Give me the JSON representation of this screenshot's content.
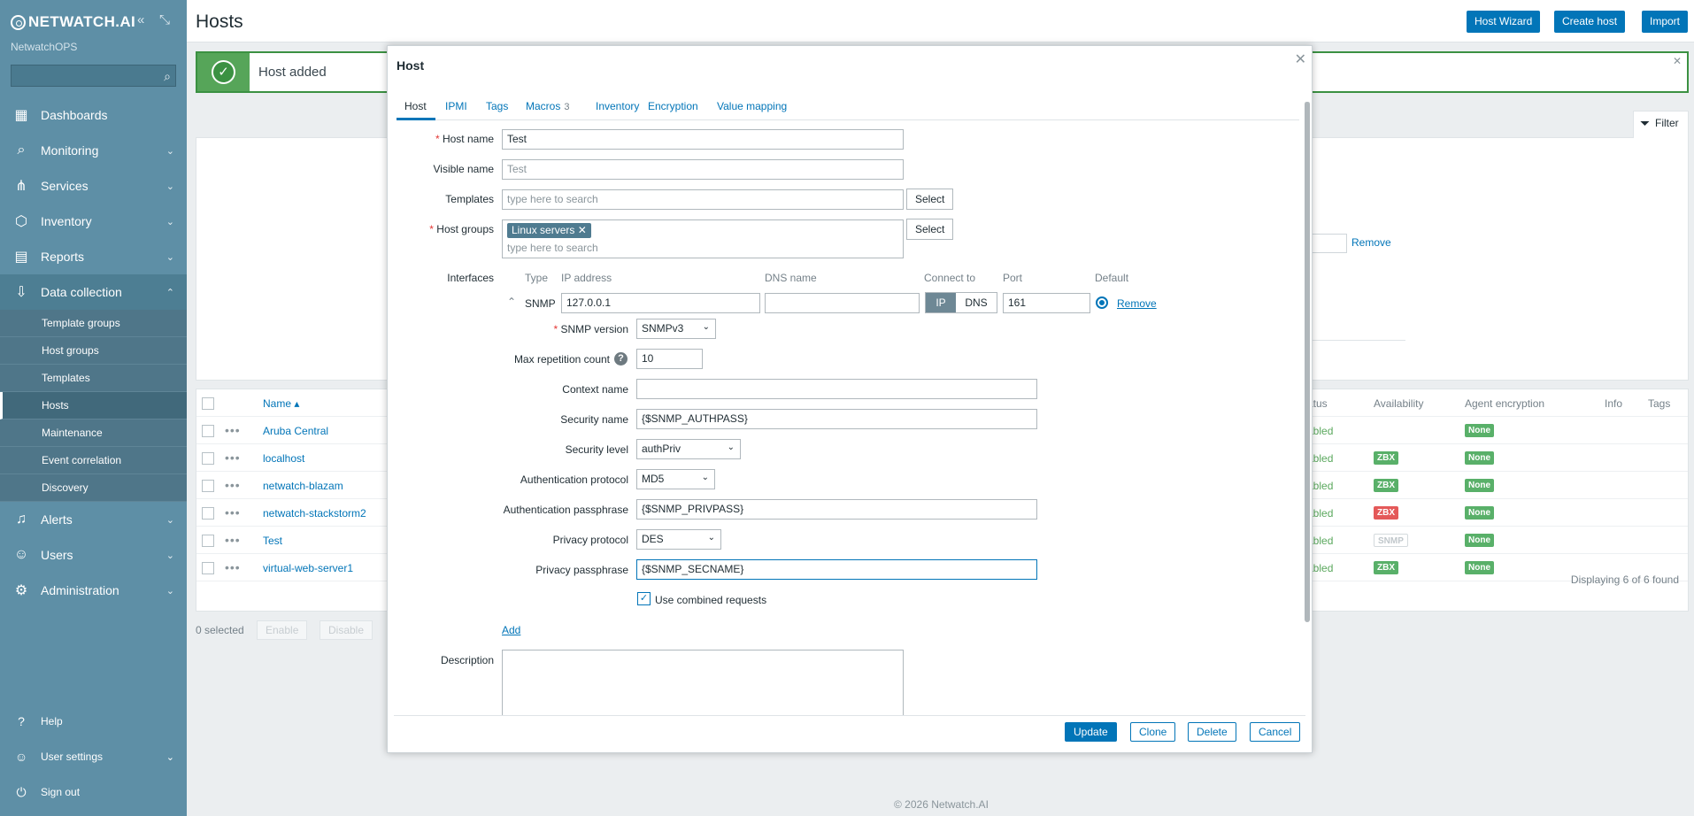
{
  "sidebar": {
    "logo": "NETWATCH.AI",
    "org": "NetwatchOPS",
    "nav": [
      {
        "label": "Dashboards",
        "icon": "dashboards-icon"
      },
      {
        "label": "Monitoring",
        "icon": "monitoring-icon"
      },
      {
        "label": "Services",
        "icon": "services-icon"
      },
      {
        "label": "Inventory",
        "icon": "inventory-icon"
      },
      {
        "label": "Reports",
        "icon": "reports-icon"
      },
      {
        "label": "Data collection",
        "icon": "data-collection-icon"
      }
    ],
    "sub": [
      "Template groups",
      "Host groups",
      "Templates",
      "Hosts",
      "Maintenance",
      "Event correlation",
      "Discovery"
    ],
    "nav2": [
      {
        "label": "Alerts",
        "icon": "alerts-icon"
      },
      {
        "label": "Users",
        "icon": "users-icon"
      },
      {
        "label": "Administration",
        "icon": "administration-icon"
      }
    ],
    "bottom": [
      "Help",
      "User settings",
      "Sign out"
    ]
  },
  "header": {
    "title": "Hosts",
    "buttons": [
      "Host Wizard",
      "Create host",
      "Import"
    ]
  },
  "message": {
    "text": "Host added"
  },
  "filter": {
    "label": "Filter",
    "remove": "Remove"
  },
  "table": {
    "headers": {
      "name": "Name ▴",
      "status": "atus",
      "availability": "Availability",
      "encryption": "Agent encryption",
      "info": "Info",
      "tags": "Tags"
    },
    "rows": [
      {
        "name": "Aruba Central",
        "status": "abled",
        "avail": "",
        "avail_type": "",
        "enc": "None"
      },
      {
        "name": "localhost",
        "status": "abled",
        "avail": "ZBX",
        "avail_type": "zbx",
        "enc": "None"
      },
      {
        "name": "netwatch-blazam",
        "status": "abled",
        "avail": "ZBX",
        "avail_type": "zbx",
        "enc": "None"
      },
      {
        "name": "netwatch-stackstorm2",
        "status": "abled",
        "avail": "ZBX",
        "avail_type": "zbx-red",
        "enc": "None"
      },
      {
        "name": "Test",
        "status": "abled",
        "avail": "SNMP",
        "avail_type": "snmp",
        "enc": "None"
      },
      {
        "name": "virtual-web-server1",
        "status": "abled",
        "avail": "ZBX",
        "avail_type": "zbx",
        "enc": "None"
      }
    ],
    "footer": "Displaying 6 of 6 found",
    "selected": "0 selected",
    "enable": "Enable",
    "disable": "Disable"
  },
  "footer": {
    "copyright": "© 2026 Netwatch.AI"
  },
  "modal": {
    "title": "Host",
    "tabs": [
      "Host",
      "IPMI",
      "Tags",
      "Macros",
      "Inventory",
      "Encryption",
      "Value mapping"
    ],
    "macros_count": "3",
    "host_name_label": "Host name",
    "host_name": "Test",
    "visible_name_label": "Visible name",
    "visible_name_placeholder": "Test",
    "templates_label": "Templates",
    "templates_placeholder": "type here to search",
    "select": "Select",
    "host_groups_label": "Host groups",
    "host_group_chip": "Linux servers",
    "host_groups_placeholder": "type here to search",
    "interfaces_label": "Interfaces",
    "iface_cols": {
      "type": "Type",
      "ip": "IP address",
      "dns": "DNS name",
      "connect": "Connect to",
      "port": "Port",
      "default": "Default"
    },
    "iface": {
      "type": "SNMP",
      "ip": "127.0.0.1",
      "dns": "",
      "connect_ip": "IP",
      "connect_dns": "DNS",
      "port": "161",
      "remove": "Remove"
    },
    "snmp_version_label": "SNMP version",
    "snmp_version": "SNMPv3",
    "max_rep_label": "Max repetition count",
    "max_rep": "10",
    "context_label": "Context name",
    "context": "",
    "security_name_label": "Security name",
    "security_name": "{$SNMP_AUTHPASS}",
    "security_level_label": "Security level",
    "security_level": "authPriv",
    "auth_protocol_label": "Authentication protocol",
    "auth_protocol": "MD5",
    "auth_pass_label": "Authentication passphrase",
    "auth_pass": "{$SNMP_PRIVPASS}",
    "priv_protocol_label": "Privacy protocol",
    "priv_protocol": "DES",
    "priv_pass_label": "Privacy passphrase",
    "priv_pass": "{$SNMP_SECNAME}",
    "combined_label": "Use combined requests",
    "add": "Add",
    "description_label": "Description",
    "buttons": [
      "Update",
      "Clone",
      "Delete",
      "Cancel"
    ]
  }
}
